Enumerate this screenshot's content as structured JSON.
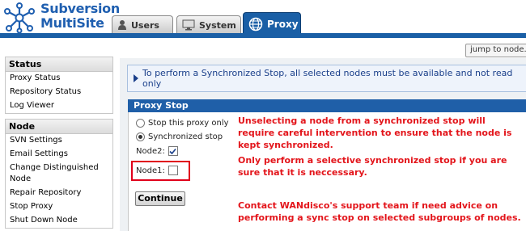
{
  "app": {
    "logo_line1": "Subversion",
    "logo_line2": "MultiSite",
    "brand_color": "#1f5fb0",
    "accent_color": "#1a5fa6"
  },
  "tabs": [
    {
      "label": "Users",
      "icon": "user-icon",
      "active": false
    },
    {
      "label": "System",
      "icon": "monitor-icon",
      "active": false
    },
    {
      "label": "Proxy",
      "icon": "globe-icon",
      "active": true
    }
  ],
  "jump": {
    "label": "jump to node..."
  },
  "sidebar": {
    "status": {
      "title": "Status",
      "items": [
        "Proxy Status",
        "Repository Status",
        "Log Viewer"
      ]
    },
    "node": {
      "title": "Node",
      "items": [
        "SVN Settings",
        "Email Settings",
        "Change Distinguished Node",
        "Repair Repository",
        "Stop Proxy",
        "Shut Down Node"
      ]
    }
  },
  "info": {
    "text": "To perform a Synchronized Stop, all selected nodes must be available and not read only",
    "icon": "info-icon"
  },
  "panel": {
    "title": "Proxy Stop",
    "options": [
      {
        "label": "Stop this proxy only",
        "selected": false
      },
      {
        "label": "Synchronized stop",
        "selected": true
      }
    ],
    "nodes": [
      {
        "label": "Node2:",
        "checked": true
      },
      {
        "label": "Node1:",
        "checked": false
      }
    ],
    "continue_label": "Continue"
  },
  "warnings": {
    "p1": "Unselecting a node from a synchronized stop will require careful intervention to ensure that the node is kept synchronized.",
    "p2": "Only perform a selective synchronized stop if you are sure that it is neccessary.",
    "p3": "Contact WANdisco's support team if need advice on performing a sync stop on selected subgroups of nodes.",
    "color": "#e3151b"
  }
}
